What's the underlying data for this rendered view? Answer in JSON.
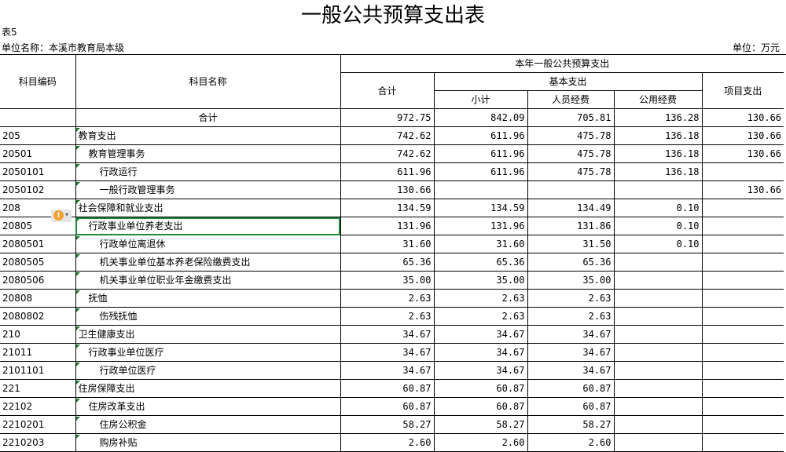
{
  "title": "一般公共预算支出表",
  "table_no": "表5",
  "unit_name": "单位名称：本溪市教育局本级",
  "unit": "单位：万元",
  "headers": {
    "code": "科目编码",
    "name": "科目名称",
    "current_year": "本年一般公共预算支出",
    "total": "合计",
    "basic": "基本支出",
    "subtotal": "小计",
    "personnel": "人员经费",
    "public": "公用经费",
    "project": "项目支出"
  },
  "rows": [
    {
      "code": "",
      "name": "合计",
      "total": "972.75",
      "subtotal": "842.09",
      "personnel": "705.81",
      "public": "136.28",
      "project": "130.66"
    },
    {
      "code": "205",
      "name": "教育支出",
      "total": "742.62",
      "subtotal": "611.96",
      "personnel": "475.78",
      "public": "136.18",
      "project": "130.66"
    },
    {
      "code": "20501",
      "name": "教育管理事务",
      "total": "742.62",
      "subtotal": "611.96",
      "personnel": "475.78",
      "public": "136.18",
      "project": "130.66"
    },
    {
      "code": "2050101",
      "name": "行政运行",
      "total": "611.96",
      "subtotal": "611.96",
      "personnel": "475.78",
      "public": "136.18",
      "project": ""
    },
    {
      "code": "2050102",
      "name": "一般行政管理事务",
      "total": "130.66",
      "subtotal": "",
      "personnel": "",
      "public": "",
      "project": "130.66"
    },
    {
      "code": "208",
      "name": "社会保障和就业支出",
      "total": "134.59",
      "subtotal": "134.59",
      "personnel": "134.49",
      "public": "0.10",
      "project": ""
    },
    {
      "code": "20805",
      "name": "行政事业单位养老支出",
      "total": "131.96",
      "subtotal": "131.96",
      "personnel": "131.86",
      "public": "0.10",
      "project": ""
    },
    {
      "code": "2080501",
      "name": "行政单位离退休",
      "total": "31.60",
      "subtotal": "31.60",
      "personnel": "31.50",
      "public": "0.10",
      "project": ""
    },
    {
      "code": "2080505",
      "name": "机关事业单位基本养老保险缴费支出",
      "total": "65.36",
      "subtotal": "65.36",
      "personnel": "65.36",
      "public": "",
      "project": ""
    },
    {
      "code": "2080506",
      "name": "机关事业单位职业年金缴费支出",
      "total": "35.00",
      "subtotal": "35.00",
      "personnel": "35.00",
      "public": "",
      "project": ""
    },
    {
      "code": "20808",
      "name": "抚恤",
      "total": "2.63",
      "subtotal": "2.63",
      "personnel": "2.63",
      "public": "",
      "project": ""
    },
    {
      "code": "2080802",
      "name": "伤残抚恤",
      "total": "2.63",
      "subtotal": "2.63",
      "personnel": "2.63",
      "public": "",
      "project": ""
    },
    {
      "code": "210",
      "name": "卫生健康支出",
      "total": "34.67",
      "subtotal": "34.67",
      "personnel": "34.67",
      "public": "",
      "project": ""
    },
    {
      "code": "21011",
      "name": "行政事业单位医疗",
      "total": "34.67",
      "subtotal": "34.67",
      "personnel": "34.67",
      "public": "",
      "project": ""
    },
    {
      "code": "2101101",
      "name": "行政单位医疗",
      "total": "34.67",
      "subtotal": "34.67",
      "personnel": "34.67",
      "public": "",
      "project": ""
    },
    {
      "code": "221",
      "name": "住房保障支出",
      "total": "60.87",
      "subtotal": "60.87",
      "personnel": "60.87",
      "public": "",
      "project": ""
    },
    {
      "code": "22102",
      "name": "住房改革支出",
      "total": "60.87",
      "subtotal": "60.87",
      "personnel": "60.87",
      "public": "",
      "project": ""
    },
    {
      "code": "2210201",
      "name": "住房公积金",
      "total": "58.27",
      "subtotal": "58.27",
      "personnel": "58.27",
      "public": "",
      "project": ""
    },
    {
      "code": "2210203",
      "name": "购房补贴",
      "total": "2.60",
      "subtotal": "2.60",
      "personnel": "2.60",
      "public": "",
      "project": ""
    }
  ],
  "warning_icon": "!",
  "warning_arrow": "▾"
}
